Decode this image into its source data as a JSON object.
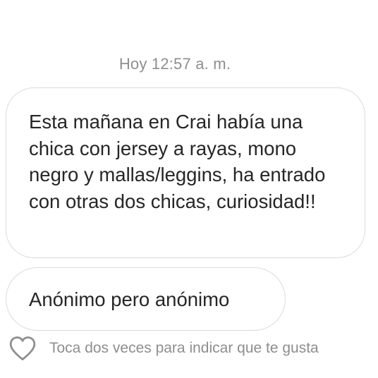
{
  "timestamp": "Hoy 12:57 a. m.",
  "messages": [
    {
      "text": "Esta mañana en Crai había una chica con jersey a rayas, mono negro y mallas/leggins, ha entrado con otras dos chicas, curiosidad!!"
    },
    {
      "text": "Anónimo pero anónimo"
    }
  ],
  "like_hint": "Toca dos veces para indicar que te gusta",
  "icons": {
    "like": "heart-outline-icon"
  },
  "colors": {
    "text": "#262626",
    "muted": "#8e8e8e",
    "bubble_border": "#dbdbdb",
    "background": "#ffffff"
  }
}
